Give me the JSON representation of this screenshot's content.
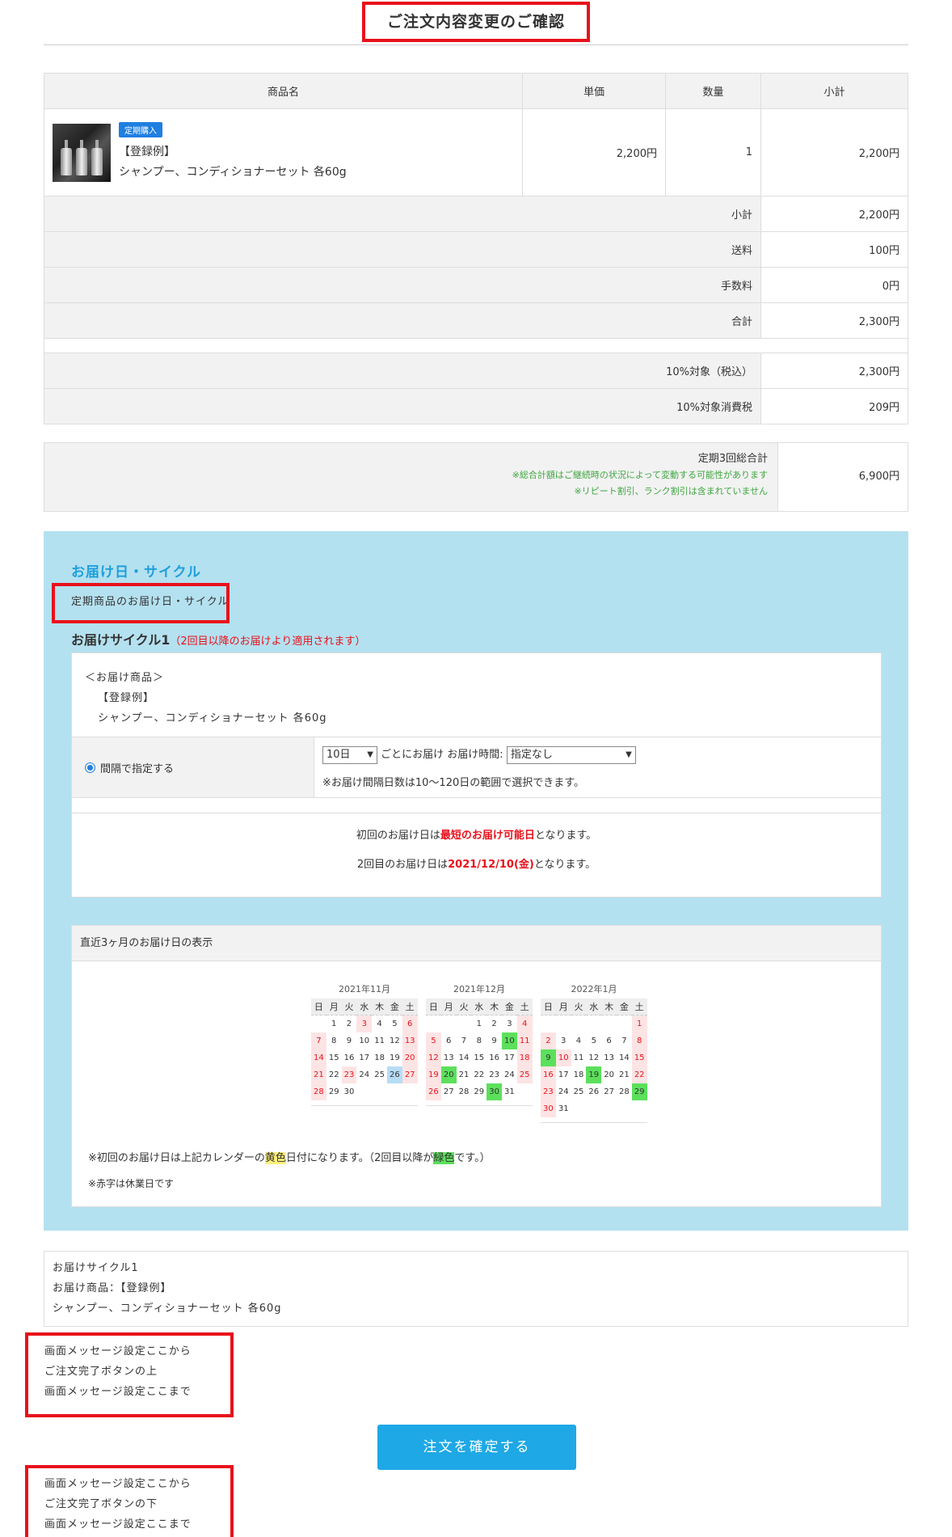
{
  "title": "ご注文内容変更のご確認",
  "table": {
    "headers": [
      "商品名",
      "単価",
      "数量",
      "小計"
    ],
    "product": {
      "badge": "定期購入",
      "name_line1": "【登録例】",
      "name_line2": "シャンプー、コンディショナーセット 各60g",
      "unit_price": "2,200円",
      "qty": "1",
      "subtotal": "2,200円"
    },
    "summary": [
      {
        "label": "小計",
        "value": "2,200円"
      },
      {
        "label": "送料",
        "value": "100円"
      },
      {
        "label": "手数料",
        "value": "0円"
      },
      {
        "label": "合計",
        "value": "2,300円"
      }
    ],
    "tax": [
      {
        "label": "10%対象（税込）",
        "value": "2,300円"
      },
      {
        "label": "10%対象消費税",
        "value": "209円"
      }
    ]
  },
  "total3": {
    "label": "定期3回総合計",
    "note1": "※総合計額はご継続時の状況によって変動する可能性があります",
    "note2": "※リピート割引、ランク割引は含まれていません",
    "value": "6,900円"
  },
  "delivery": {
    "title": "お届け日・サイクル",
    "subtitle": "定期商品のお届け日・サイクル",
    "cycle_label": "お届けサイクル1",
    "cycle_note": "（2回目以降のお届けより適用されます）",
    "goods_line1": "＜お届け商品＞",
    "goods_line2": "【登録例】",
    "goods_line3": "シャンプー、コンディショナーセット 各60g",
    "radio_label": "間隔で指定する",
    "interval_value": "10日",
    "interval_text": "ごとにお届け",
    "time_label": "お届け時間:",
    "time_value": "指定なし",
    "interval_note": "※お届け間隔日数は10〜120日の範囲で選択できます。",
    "first_pre": "初回のお届け日は",
    "first_em": "最短のお届け可能日",
    "first_post": "となります。",
    "second_pre": "2回目のお届け日は",
    "second_em": "2021/12/10(金)",
    "second_post": "となります。",
    "calendar_header": "直近3ヶ月のお届け日の表示",
    "weekdays": [
      "日",
      "月",
      "火",
      "水",
      "木",
      "金",
      "土"
    ],
    "months": [
      {
        "label": "2021年11月",
        "offset": 1,
        "days": 30,
        "holidays": [
          3,
          23
        ],
        "green": [],
        "blue": [
          26
        ]
      },
      {
        "label": "2021年12月",
        "offset": 3,
        "days": 31,
        "holidays": [],
        "green": [
          10,
          20,
          30
        ],
        "blue": []
      },
      {
        "label": "2022年1月",
        "offset": 6,
        "days": 31,
        "holidays": [
          1,
          10
        ],
        "green": [
          9,
          19,
          29
        ],
        "blue": []
      }
    ],
    "note1_pre": "※初回のお届け日は上記カレンダーの",
    "note1_yellow": "黄色",
    "note1_mid": "日付になります。（2回目以降が",
    "note1_green": "緑色",
    "note1_post": "です。）",
    "note2": "※赤字は休業日です"
  },
  "bottom_summary": {
    "line1": "お届けサイクル1",
    "line2": "お届け商品：【登録例】",
    "line3": "シャンプー、コンディショナーセット 各60g"
  },
  "msg_top": [
    "画面メッセージ設定ここから",
    "ご注文完了ボタンの上",
    "画面メッセージ設定ここまで"
  ],
  "confirm_button": "注文を確定する",
  "msg_bottom": [
    "画面メッセージ設定ここから",
    "ご注文完了ボタンの下",
    "画面メッセージ設定ここまで"
  ]
}
